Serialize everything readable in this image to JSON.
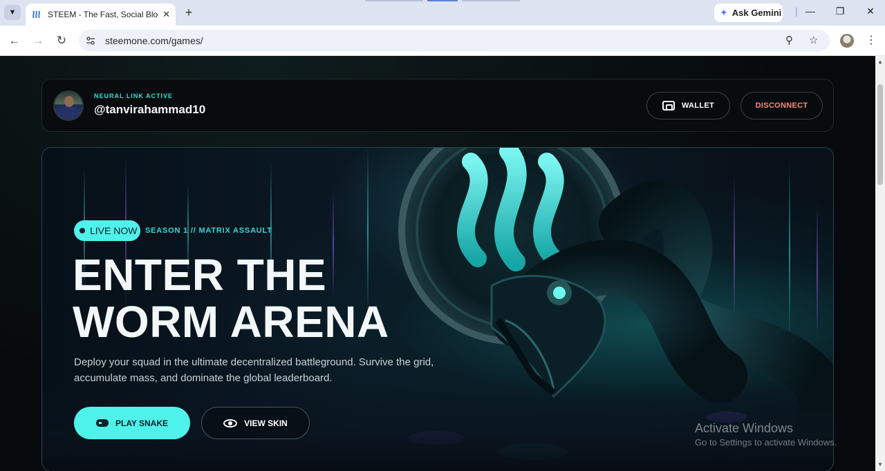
{
  "browser": {
    "tab_title": "STEEM - The Fast, Social Blockchain",
    "close_glyph": "✕",
    "new_tab_glyph": "+",
    "gemini_label": "Ask Gemini",
    "url": "steemone.com/games/",
    "icons": {
      "tab_search": "chevron-down-icon",
      "back": "back-arrow-icon",
      "forward": "forward-arrow-icon",
      "reload": "reload-icon",
      "password": "key-icon",
      "bookmark": "star-icon",
      "menu": "kebab-menu-icon"
    }
  },
  "profile": {
    "status": "NEURAL LINK ACTIVE",
    "username": "@tanvirahammad10",
    "wallet_label": "WALLET",
    "disconnect_label": "DISCONNECT"
  },
  "hero": {
    "live_label": "LIVE NOW",
    "season": "SEASON 1 // MATRIX ASSAULT",
    "headline_line1": "ENTER THE",
    "headline_line2": "WORM ARENA",
    "description": "Deploy your squad in the ultimate decentralized battleground. Survive the grid, accumulate mass, and dominate the global leaderboard.",
    "play_label": "PLAY SNAKE",
    "skin_label": "VIEW SKIN"
  },
  "watermark": {
    "title": "Activate Windows",
    "subtitle": "Go to Settings to activate Windows."
  },
  "colors": {
    "accent": "#4ff2ea",
    "disconnect": "#ff8a7a",
    "background": "#070a0c"
  }
}
